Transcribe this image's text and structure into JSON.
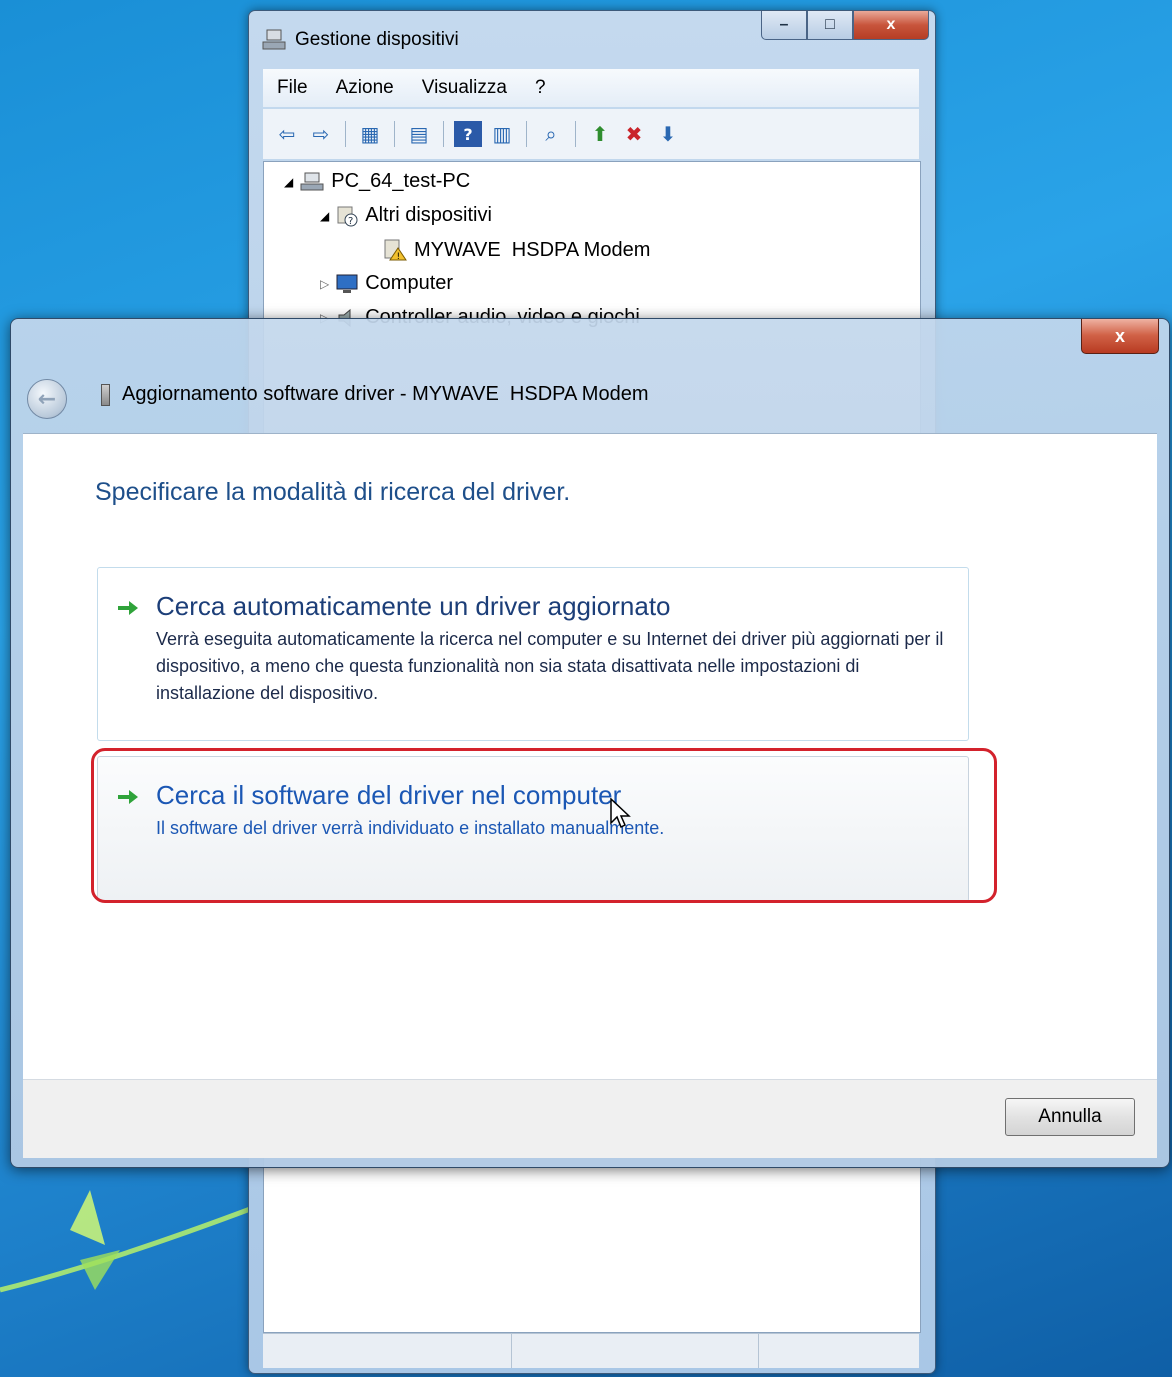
{
  "device_manager": {
    "title": "Gestione dispositivi",
    "caption_buttons": {
      "minimize": "–",
      "maximize": "□",
      "close": "x"
    },
    "menu": [
      "File",
      "Azione",
      "Visualizza",
      "?"
    ],
    "toolbar_icons": [
      "back-icon",
      "forward-icon",
      "properties-icon",
      "show-hide-icon",
      "help-icon",
      "view-icon",
      "scan-hardware-icon",
      "update-driver-icon",
      "uninstall-icon",
      "disable-icon"
    ],
    "tree": {
      "root": "PC_64_test-PC",
      "groups": [
        {
          "label": "Altri dispositivi",
          "children": [
            "MYWAVE  HSDPA Modem"
          ]
        },
        {
          "label": "Computer"
        },
        {
          "label": "Controller audio, video e giochi"
        }
      ]
    }
  },
  "wizard": {
    "close_label": "x",
    "window_title": "Aggiornamento software driver - MYWAVE  HSDPA Modem",
    "instruction": "Specificare la modalità di ricerca del driver.",
    "options": [
      {
        "title": "Cerca automaticamente un driver aggiornato",
        "description": "Verrà eseguita automaticamente la ricerca nel computer e su Internet dei driver più aggiornati per il dispositivo, a meno che questa funzionalità non sia stata disattivata nelle impostazioni di installazione del dispositivo."
      },
      {
        "title": "Cerca il software del driver nel computer",
        "description": "Il software del driver verrà individuato e installato manualmente."
      }
    ],
    "cancel_label": "Annulla",
    "colors": {
      "highlight": "#d3222c",
      "arrow": "#2fa33a",
      "instruction": "#1e4f8a",
      "link": "#1b57b4"
    }
  }
}
